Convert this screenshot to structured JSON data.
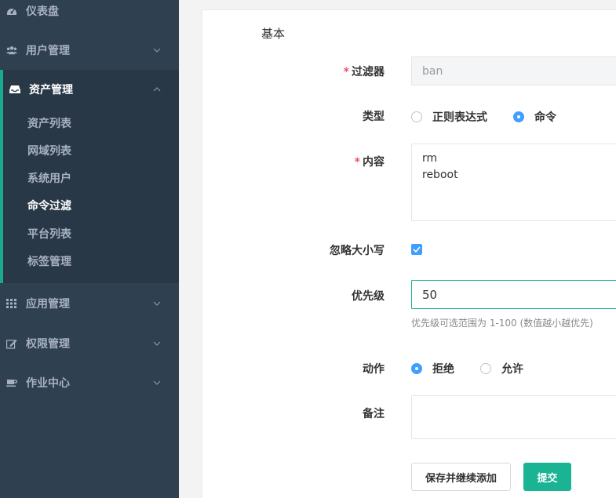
{
  "sidebar": {
    "items": [
      {
        "label": "仪表盘",
        "icon": "dashboard-icon"
      },
      {
        "label": "用户管理",
        "icon": "users-icon"
      },
      {
        "label": "资产管理",
        "icon": "inbox-icon"
      },
      {
        "label": "应用管理",
        "icon": "apps-grid-icon"
      },
      {
        "label": "权限管理",
        "icon": "edit-icon"
      },
      {
        "label": "作业中心",
        "icon": "coffee-icon"
      }
    ],
    "submenu": [
      "资产列表",
      "网域列表",
      "系统用户",
      "命令过滤",
      "平台列表",
      "标签管理"
    ],
    "current_submenu": "命令过滤"
  },
  "form": {
    "section_title": "基本",
    "filter": {
      "label": "过滤器",
      "value": "ban"
    },
    "type": {
      "label": "类型",
      "options": [
        "正则表达式",
        "命令"
      ],
      "selected": "命令"
    },
    "content": {
      "label": "内容",
      "lines": [
        "rm",
        "reboot"
      ]
    },
    "ignore_case": {
      "label": "忽略大小写",
      "checked": true
    },
    "priority": {
      "label": "优先级",
      "value": "50",
      "hint": "优先级可选范围为 1-100 (数值越小越优先)"
    },
    "action": {
      "label": "动作",
      "options": [
        "拒绝",
        "允许"
      ],
      "selected": "拒绝"
    },
    "comment": {
      "label": "备注",
      "value": ""
    },
    "buttons": {
      "save_continue": "保存并继续添加",
      "submit": "提交"
    }
  },
  "colors": {
    "sidebar_bg": "#2f4050",
    "accent": "#1ab394",
    "radio_blue": "#409eff",
    "required": "#ed5565"
  }
}
